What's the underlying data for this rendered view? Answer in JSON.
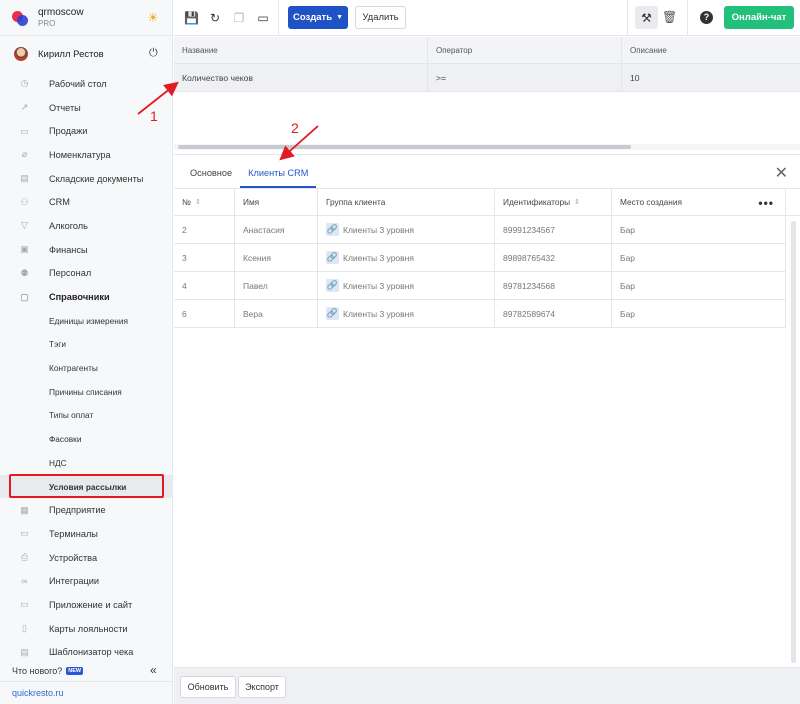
{
  "brand": {
    "name": "qrmoscow",
    "plan": "PRO"
  },
  "user": {
    "name": "Кирилл Рестов"
  },
  "nav": [
    {
      "label": "Рабочий стол",
      "icon": "dashboard-icon",
      "glyph": "◷"
    },
    {
      "label": "Отчеты",
      "icon": "reports-icon",
      "glyph": "↗"
    },
    {
      "label": "Продажи",
      "icon": "sales-icon",
      "glyph": "▭"
    },
    {
      "label": "Номенклатура",
      "icon": "nomenclature-icon",
      "glyph": "⌀"
    },
    {
      "label": "Складские документы",
      "icon": "warehouse-icon",
      "glyph": "▤"
    },
    {
      "label": "CRM",
      "icon": "crm-icon",
      "glyph": "⚇"
    },
    {
      "label": "Алкоголь",
      "icon": "alcohol-icon",
      "glyph": "▽"
    },
    {
      "label": "Финансы",
      "icon": "finance-icon",
      "glyph": "▣"
    },
    {
      "label": "Персонал",
      "icon": "staff-icon",
      "glyph": "⚉"
    },
    {
      "label": "Справочники",
      "icon": "directory-icon",
      "glyph": "▢"
    }
  ],
  "sub_nav": [
    "Единицы измерения",
    "Тэги",
    "Контрагенты",
    "Причины списания",
    "Типы оплат",
    "Фасовки",
    "НДС",
    "Условия рассылки"
  ],
  "nav_after": [
    {
      "label": "Предприятие",
      "icon": "enterprise-icon",
      "glyph": "▦"
    },
    {
      "label": "Терминалы",
      "icon": "terminal-icon",
      "glyph": "▭"
    },
    {
      "label": "Устройства",
      "icon": "printer-icon",
      "glyph": "⎙"
    },
    {
      "label": "Интеграции",
      "icon": "integration-icon",
      "glyph": "∞"
    },
    {
      "label": "Приложение и сайт",
      "icon": "app-icon",
      "glyph": "▭"
    },
    {
      "label": "Карты лояльности",
      "icon": "loyalty-icon",
      "glyph": "▯"
    },
    {
      "label": "Шаблонизатор чека",
      "icon": "receipt-icon",
      "glyph": "▤"
    }
  ],
  "footer_nav": {
    "whats_new": "Что нового?",
    "new_badge": "NEW",
    "site": "quickresto.ru"
  },
  "toolbar": {
    "create": "Создать",
    "delete": "Удалить",
    "chat": "Онлайн-чат"
  },
  "top_table": {
    "columns": [
      "Название",
      "Оператор",
      "Описание"
    ],
    "row": [
      "Количество чеков",
      ">=",
      "10"
    ]
  },
  "tabs": [
    "Основное",
    "Клиенты CRM"
  ],
  "detail_table": {
    "columns": [
      "№",
      "Имя",
      "Группа клиента",
      "Идентификаторы",
      "Место создания"
    ],
    "rows": [
      [
        "2",
        "Анастасия",
        "Клиенты 3 уровня",
        "89991234567",
        "Бар"
      ],
      [
        "3",
        "Ксения",
        "Клиенты 3 уровня",
        "89898765432",
        "Бар"
      ],
      [
        "4",
        "Павел",
        "Клиенты 3 уровня",
        "89781234568",
        "Бар"
      ],
      [
        "6",
        "Вера",
        "Клиенты 3 уровня",
        "89782589674",
        "Бар"
      ]
    ]
  },
  "footer": {
    "refresh": "Обновить",
    "export": "Экспорт"
  },
  "annotations": [
    "1",
    "2"
  ],
  "colors": {
    "primary": "#1f52c4",
    "accent": "#22c07a",
    "highlight": "#e01b24"
  }
}
